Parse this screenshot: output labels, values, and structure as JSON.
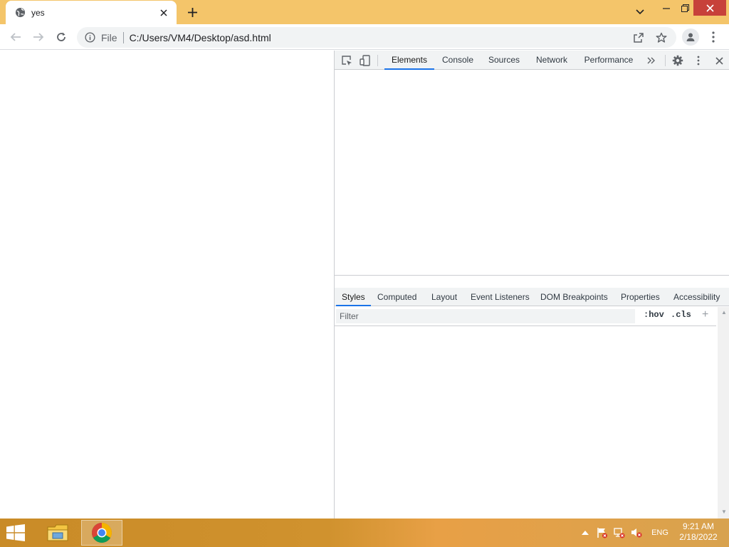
{
  "browser": {
    "tab": {
      "title": "yes"
    },
    "omnibox": {
      "scheme_label": "File",
      "url": "C:/Users/VM4/Desktop/asd.html"
    }
  },
  "devtools": {
    "main_tabs": [
      "Elements",
      "Console",
      "Sources",
      "Network",
      "Performance"
    ],
    "active_main_tab": "Elements",
    "sub_tabs": [
      "Styles",
      "Computed",
      "Layout",
      "Event Listeners",
      "DOM Breakpoints",
      "Properties",
      "Accessibility"
    ],
    "active_sub_tab": "Styles",
    "filter": {
      "placeholder": "Filter",
      "hov_label": ":hov",
      "cls_label": ".cls"
    }
  },
  "taskbar": {
    "apps": [
      "file-explorer",
      "google-chrome"
    ],
    "tray": {
      "language": "ENG"
    },
    "clock": {
      "time": "9:21 AM",
      "date": "2/18/2022"
    }
  },
  "colors": {
    "titlebar": "#f4c56a",
    "close_button": "#c7413a",
    "devtools_accent": "#1a73e8",
    "taskbar": "#c98b27"
  }
}
